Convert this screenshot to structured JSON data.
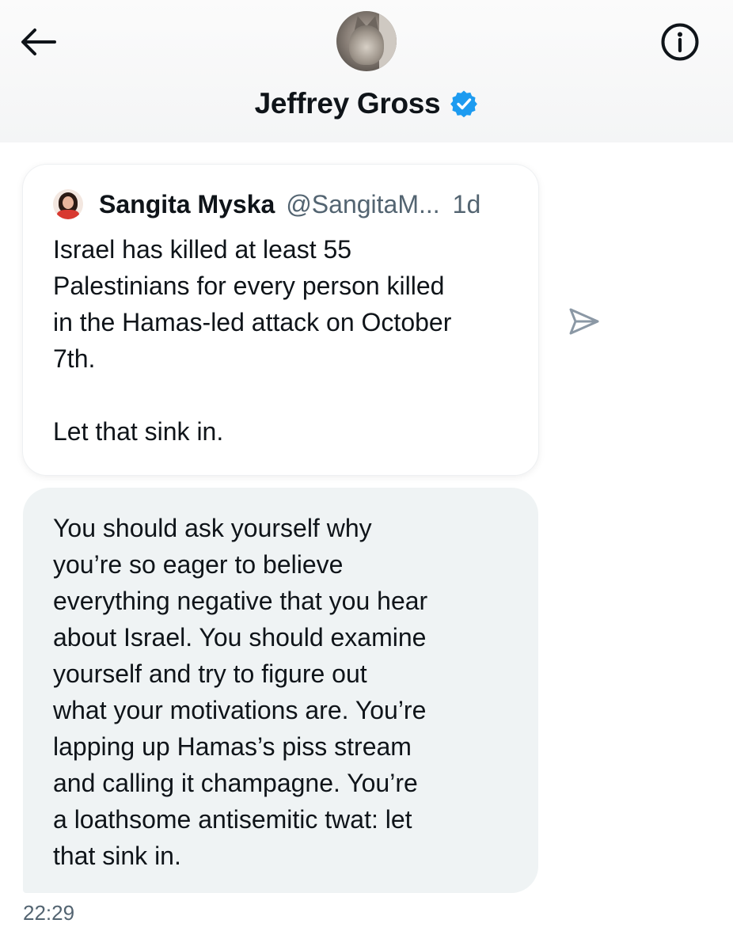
{
  "header": {
    "title": "Jeffrey Gross",
    "verified": true,
    "back_icon": "arrow-left-icon",
    "info_icon": "info-circle-icon",
    "verified_color": "#1d9bf0"
  },
  "shared_tweet": {
    "author_name": "Sangita Myska",
    "author_handle": "@SangitaM...",
    "time_ago": "1d",
    "text": "Israel has killed at least 55\nPalestinians for every person killed\nin the Hamas-led attack on October\n7th.\n\nLet that sink in."
  },
  "message": {
    "text": "You should ask yourself why\nyou’re so eager to believe\neverything negative that you hear\nabout Israel. You should examine\nyourself and try to figure out\nwhat your motivations are. You’re\nlapping up Hamas’s piss stream\nand calling it champagne. You’re\na loathsome antisemitic twat: let\nthat sink in.",
    "timestamp": "22:29"
  },
  "icons": {
    "share": "send-icon"
  }
}
